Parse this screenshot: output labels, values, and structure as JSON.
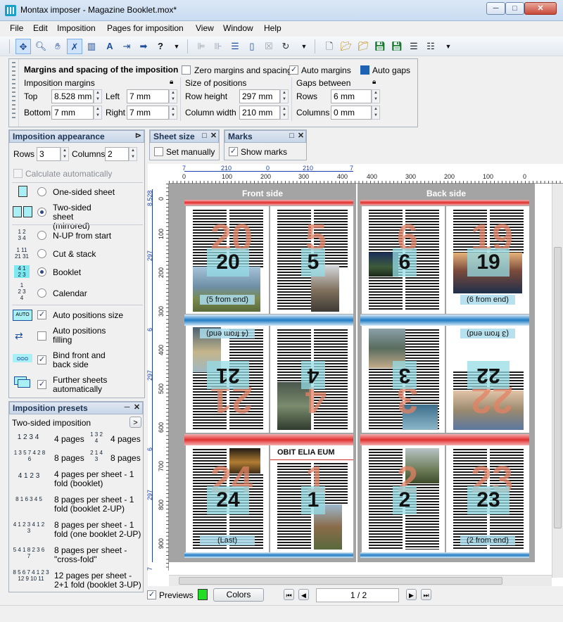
{
  "window": {
    "title": "Montax imposer - Magazine Booklet.mox*",
    "min": "─",
    "max": "□",
    "close": "✕"
  },
  "menu": [
    "File",
    "Edit",
    "Imposition",
    "Pages for imposition",
    "View",
    "Window",
    "Help"
  ],
  "margins": {
    "title": "Margins and spacing of the imposition",
    "zero_label": "Zero margins and spacing",
    "zero_checked": false,
    "auto_margins_label": "Auto margins",
    "auto_margins_checked": true,
    "auto_gaps_label": "Auto gaps",
    "auto_gaps_checked": true,
    "imposition_margins": "Imposition margins",
    "top_label": "Top",
    "top": "8.528 mm",
    "left_label": "Left",
    "left": "7 mm",
    "bottom_label": "Bottom",
    "bottom": "7 mm",
    "right_label": "Right",
    "right": "7 mm",
    "size_positions": "Size of positions",
    "row_height_label": "Row height",
    "row_height": "297 mm",
    "col_width_label": "Column width",
    "col_width": "210 mm",
    "gaps_between": "Gaps between",
    "rows_label": "Rows",
    "rows_gap": "6 mm",
    "columns_label": "Columns",
    "columns_gap": "0 mm"
  },
  "appearance": {
    "title": "Imposition appearance",
    "rows_label": "Rows",
    "rows": "3",
    "columns_label": "Columns",
    "columns": "2",
    "calc_auto": "Calculate automatically",
    "sheet_types": [
      {
        "label": "One-sided sheet",
        "selected": false
      },
      {
        "label": "Two-sided sheet (mirrored)",
        "selected": true
      }
    ],
    "orders": [
      {
        "label": "N-UP from start",
        "selected": false,
        "icon": [
          "1",
          "2",
          "3",
          "4"
        ]
      },
      {
        "label": "Cut & stack",
        "selected": false,
        "icon": [
          "1",
          "11",
          "21",
          "31"
        ]
      },
      {
        "label": "Booklet",
        "selected": true,
        "icon": [
          "4",
          "1",
          "2",
          "3"
        ]
      },
      {
        "label": "Calendar",
        "selected": false,
        "icon": [
          "1",
          "2",
          "3",
          "4"
        ]
      }
    ],
    "options": [
      {
        "label": "Auto positions size",
        "checked": true
      },
      {
        "label": "Auto positions filling",
        "checked": false
      },
      {
        "label": "Bind front and back side",
        "checked": true
      },
      {
        "label": "Further sheets automatically",
        "checked": true
      }
    ]
  },
  "sheet_size": {
    "title": "Sheet size",
    "set_manually": "Set manually",
    "checked": false
  },
  "marks": {
    "title": "Marks",
    "show_marks": "Show marks",
    "checked": true
  },
  "presets": {
    "title": "Imposition presets",
    "selected": "Two-sided imposition",
    "items": [
      {
        "label": "4 pages",
        "icon": "1 2 3 4"
      },
      {
        "label": "4 pages",
        "icon": "1 3 2 4"
      },
      {
        "label": "8 pages",
        "icon": "1 3 5 7 4 2 8 6"
      },
      {
        "label": "8 pages",
        "icon": "2 1 4 3"
      },
      {
        "label": "4 pages per sheet - 1 fold (booklet)",
        "icon": "4 1 2 3"
      },
      {
        "label": "8 pages per sheet - 1 fold (booklet 2-UP)",
        "icon": "8 1 6 3 4 5"
      },
      {
        "label": "8 pages per sheet - 1 fold (one booklet 2-UP)",
        "icon": "4 1 2 3 4 1 2 3"
      },
      {
        "label": "8 pages per sheet - \"cross-fold\"",
        "icon": "5 4 1 8 2 3 6 7"
      },
      {
        "label": "12 pages per sheet - 2+1 fold (booklet 3-UP)",
        "icon": "8 5 6 7 4 1 2 3 12 9 10 11"
      }
    ]
  },
  "canvas": {
    "front_label": "Front side",
    "back_label": "Back side",
    "ruler_top_front": [
      "0",
      "100",
      "200",
      "300",
      "400"
    ],
    "ruler_top_back": [
      "400",
      "300",
      "200",
      "100",
      "0"
    ],
    "dim_top": [
      "7",
      "210",
      "0",
      "210",
      "7"
    ],
    "ruler_left": [
      "0",
      "100",
      "200",
      "300",
      "400",
      "500",
      "600",
      "700",
      "800",
      "900"
    ],
    "dim_left": [
      "8.528",
      "297",
      "6",
      "297",
      "6",
      "297",
      "7"
    ],
    "front_pages": [
      {
        "num": "20",
        "note": "(5 from end)",
        "flip": false
      },
      {
        "num": "5",
        "note": "",
        "flip": false
      },
      {
        "num": "21",
        "note": "(4 from end)",
        "flip": true
      },
      {
        "num": "4",
        "note": "",
        "flip": true
      },
      {
        "num": "24",
        "note": "(Last)",
        "flip": false
      },
      {
        "num": "1",
        "note": "",
        "flip": false,
        "headline": "OBIT ELIA EUM"
      }
    ],
    "back_pages": [
      {
        "num": "6",
        "note": "",
        "flip": false
      },
      {
        "num": "19",
        "note": "(6 from end)",
        "flip": false
      },
      {
        "num": "3",
        "note": "",
        "flip": true
      },
      {
        "num": "22",
        "note": "(3 from end)",
        "flip": true
      },
      {
        "num": "2",
        "note": "",
        "flip": false
      },
      {
        "num": "23",
        "note": "(2 from end)",
        "flip": false
      }
    ]
  },
  "bottom": {
    "previews": "Previews",
    "previews_checked": true,
    "preview_color": "#22dd22",
    "colors_btn": "Colors",
    "page_indicator": "1 / 2"
  }
}
